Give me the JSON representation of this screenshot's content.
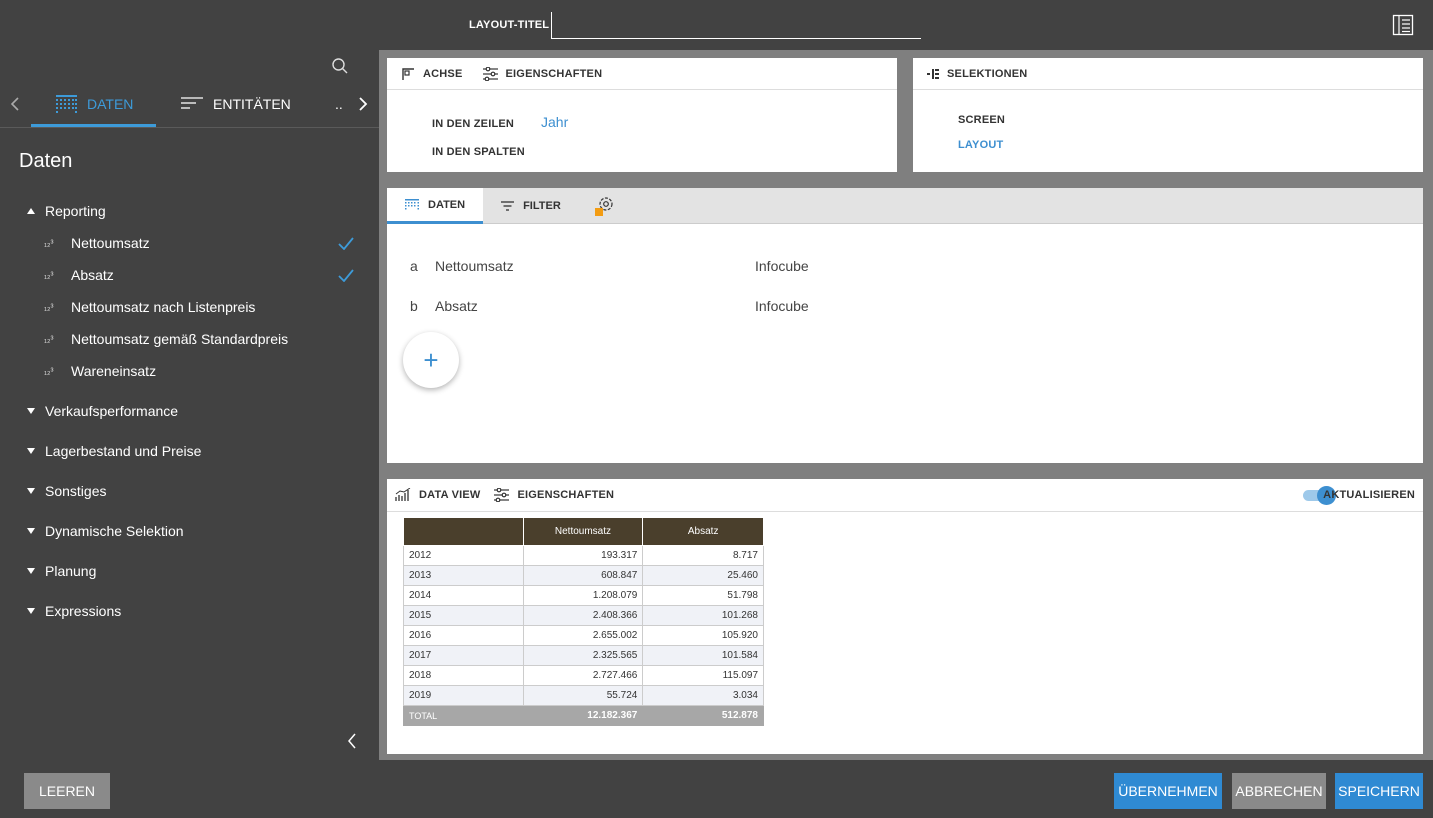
{
  "header": {
    "title_label": "LAYOUT-TITEL",
    "title_value": ""
  },
  "sidebar": {
    "tabs": [
      {
        "label": "DATEN"
      },
      {
        "label": "ENTITÄTEN"
      }
    ],
    "more": "..",
    "heading": "Daten",
    "groups": [
      {
        "label": "Reporting",
        "expanded": true
      },
      {
        "label": "Verkaufsperformance"
      },
      {
        "label": "Lagerbestand und Preise"
      },
      {
        "label": "Sonstiges"
      },
      {
        "label": "Dynamische Selektion"
      },
      {
        "label": "Planung"
      },
      {
        "label": "Expressions"
      }
    ],
    "items": [
      {
        "label": "Nettoumsatz",
        "checked": true
      },
      {
        "label": "Absatz",
        "checked": true
      },
      {
        "label": "Nettoumsatz nach Listenpreis",
        "checked": false
      },
      {
        "label": "Nettoumsatz gemäß Standardpreis",
        "checked": false
      },
      {
        "label": "Wareneinsatz",
        "checked": false
      }
    ]
  },
  "axis_panel": {
    "tab_axis": "ACHSE",
    "tab_props": "EIGENSCHAFTEN",
    "rows_label": "IN DEN ZEILEN",
    "rows_value": "Jahr",
    "cols_label": "IN DEN SPALTEN"
  },
  "selection_panel": {
    "title": "SELEKTIONEN",
    "screen": "SCREEN",
    "layout": "LAYOUT"
  },
  "data_panel": {
    "tab_data": "DATEN",
    "tab_filter": "FILTER",
    "rows": [
      {
        "letter": "a",
        "name": "Nettoumsatz",
        "source": "Infocube"
      },
      {
        "letter": "b",
        "name": "Absatz",
        "source": "Infocube"
      }
    ],
    "add": "+"
  },
  "dataview": {
    "tab_view": "DATA VIEW",
    "tab_props": "EIGENSCHAFTEN",
    "toggle_label": "AKTUALISIEREN",
    "toggle_on": true,
    "table": {
      "headers": [
        "",
        "Nettoumsatz",
        "Absatz"
      ],
      "rows": [
        [
          "2012",
          "193.317",
          "8.717"
        ],
        [
          "2013",
          "608.847",
          "25.460"
        ],
        [
          "2014",
          "1.208.079",
          "51.798"
        ],
        [
          "2015",
          "2.408.366",
          "101.268"
        ],
        [
          "2016",
          "2.655.002",
          "105.920"
        ],
        [
          "2017",
          "2.325.565",
          "101.584"
        ],
        [
          "2018",
          "2.727.466",
          "115.097"
        ],
        [
          "2019",
          "55.724",
          "3.034"
        ]
      ],
      "total": [
        "TOTAL",
        "12.182.367",
        "512.878"
      ]
    }
  },
  "footer": {
    "clear": "LEEREN",
    "apply": "ÜBERNEHMEN",
    "cancel": "ABBRECHEN",
    "save": "SPEICHERN"
  },
  "colors": {
    "accent": "#3d8fd0",
    "bg_dark": "#424242",
    "table_header": "#4a3f2c",
    "button_blue": "#2f8ad3",
    "button_grey": "#8a8a8a"
  }
}
